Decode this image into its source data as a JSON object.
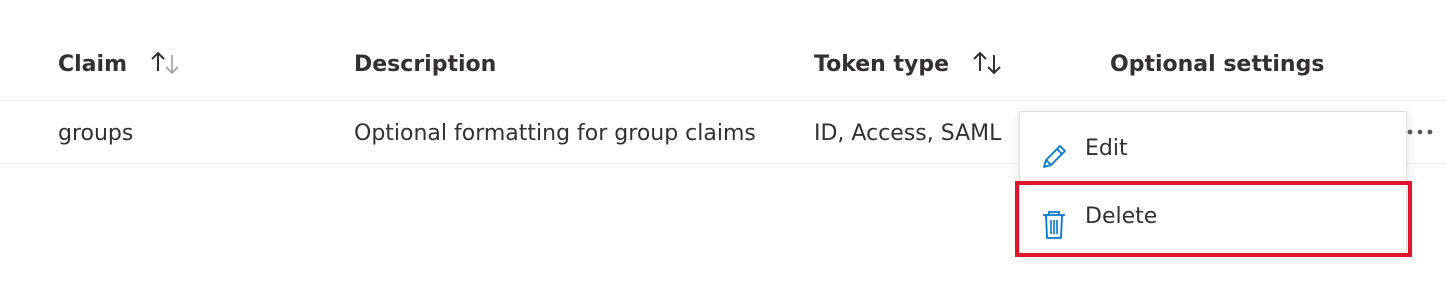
{
  "table": {
    "columns": [
      {
        "label": "Claim",
        "sortable": true
      },
      {
        "label": "Description",
        "sortable": false
      },
      {
        "label": "Token type",
        "sortable": true
      },
      {
        "label": "Optional settings",
        "sortable": false
      }
    ],
    "rows": [
      {
        "claim": "groups",
        "description": "Optional formatting for group claims",
        "token_type": "ID, Access, SAML",
        "more_icon": "ellipsis-icon"
      }
    ]
  },
  "context_menu": {
    "items": [
      {
        "label": "Edit",
        "icon": "pencil-icon"
      },
      {
        "label": "Delete",
        "icon": "trash-icon"
      }
    ]
  },
  "colors": {
    "icon_blue": "#0078d4",
    "highlight_red": "#e0152b",
    "text": "#323130",
    "border": "#edebe9"
  }
}
